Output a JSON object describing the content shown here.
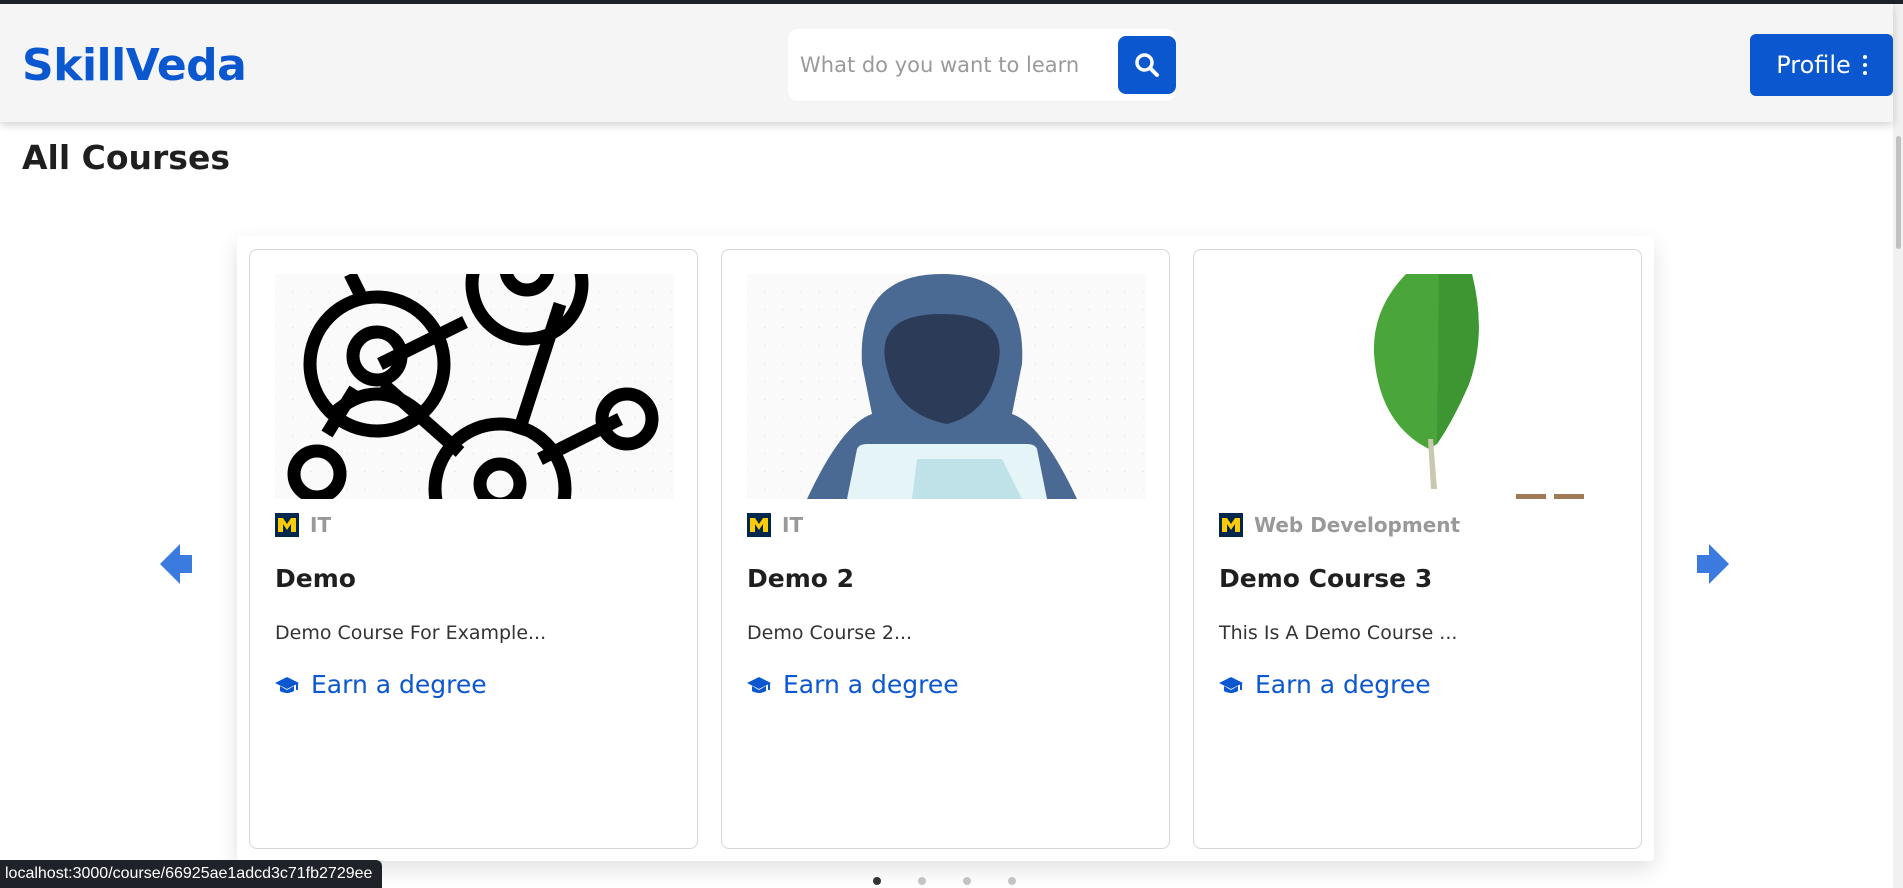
{
  "app": {
    "name": "SkillVeda"
  },
  "search": {
    "placeholder": "What do you want to learn"
  },
  "profile": {
    "label": "Profile"
  },
  "page": {
    "title": "All Courses"
  },
  "courses": [
    {
      "category": "IT",
      "title": "Demo",
      "description": "Demo Course For Example...",
      "link": "Earn a degree",
      "image": "network-people-icon"
    },
    {
      "category": "IT",
      "title": "Demo 2",
      "description": "Demo Course 2...",
      "link": "Earn a degree",
      "image": "hooded-hacker-icon"
    },
    {
      "category": "Web Development",
      "title": "Demo Course 3",
      "description": "This Is A Demo Course ...",
      "link": "Earn a degree",
      "image": "mongodb-leaf-icon"
    }
  ],
  "carousel": {
    "page_count": 4,
    "active_page": 1
  },
  "status": {
    "url": "localhost:3000/course/66925ae1adcd3c71fb2729ee"
  },
  "colors": {
    "brand": "#0b57d0",
    "arrow": "#3b7be0",
    "university": "#00274c",
    "university_accent": "#ffcb05"
  }
}
